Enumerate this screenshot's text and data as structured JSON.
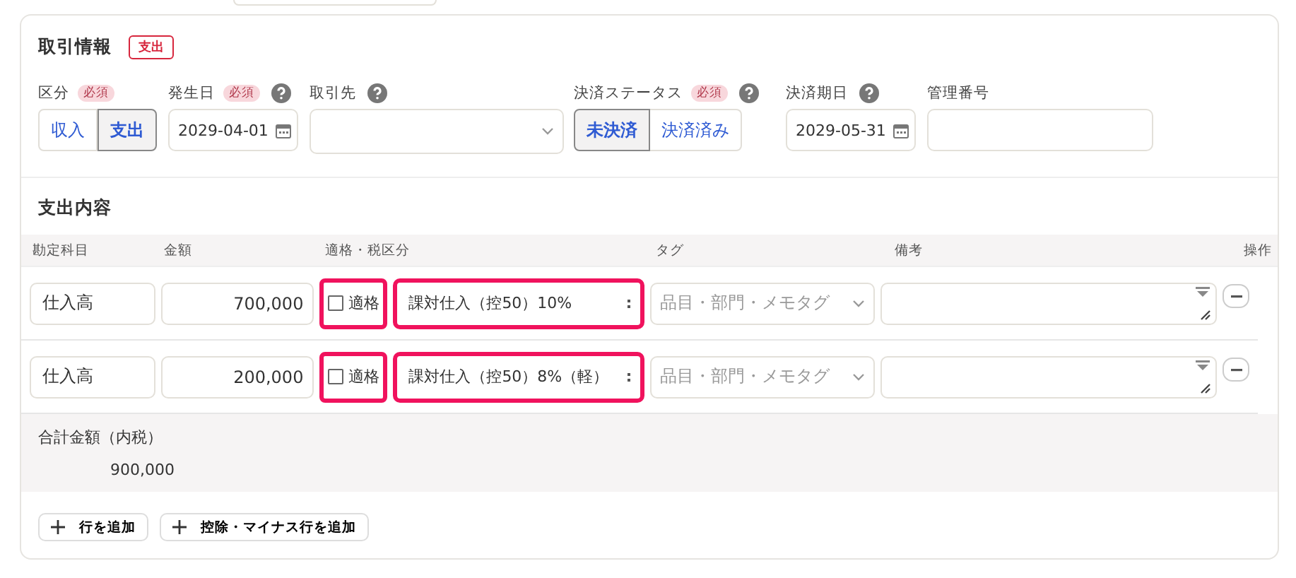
{
  "header": {
    "title": "取引情報",
    "badge": "支出"
  },
  "fields": [
    {
      "kind": "segmented",
      "label": "区分",
      "badge": "必須",
      "help": false,
      "options": [
        {
          "label": "収入",
          "selected": false
        },
        {
          "label": "支出",
          "selected": true
        }
      ]
    },
    {
      "kind": "date",
      "label": "発生日",
      "badge": "必須",
      "help": true,
      "value": "2029-04-01"
    },
    {
      "kind": "select",
      "label": "取引先",
      "help": true
    },
    {
      "kind": "segmented",
      "label": "決済ステータス",
      "badge": "必須",
      "help": true,
      "options": [
        {
          "label": "未決済",
          "selected": true
        },
        {
          "label": "決済済み",
          "selected": false
        }
      ]
    },
    {
      "kind": "date",
      "label": "決済期日",
      "help": true,
      "value": "2029-05-31"
    },
    {
      "kind": "text",
      "label": "管理番号",
      "help": false
    }
  ],
  "lines": {
    "title": "支出内容",
    "columns": [
      "勘定科目",
      "金額",
      "適格・税区分",
      "タグ",
      "備考",
      "操作"
    ],
    "rows": [
      {
        "account": "仕入高",
        "amount": "700,000",
        "qualified_label": "適格",
        "qualified": false,
        "tax": "課対仕入（控50）10%",
        "tag_placeholder": "品目・部門・メモタグ",
        "highlighted": true
      },
      {
        "account": "仕入高",
        "amount": "200,000",
        "qualified_label": "適格",
        "qualified": false,
        "tax": "課対仕入（控50）8%（軽）",
        "tag_placeholder": "品目・部門・メモタグ",
        "highlighted": true
      }
    ],
    "total_label": "合計金額（内税）",
    "total": "900,000"
  },
  "buttons": [
    "行を追加",
    "控除・マイナス行を追加"
  ]
}
